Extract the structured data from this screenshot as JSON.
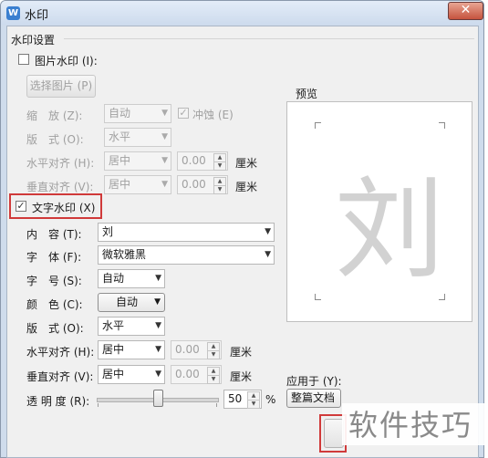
{
  "window": {
    "title": "水印",
    "app_icon": "wps-icon",
    "close_glyph": "✕"
  },
  "group": {
    "title": "水印设置"
  },
  "picture": {
    "checkbox_label": "图片水印 (I):",
    "checked": false,
    "select_button": "选择图片 (P)",
    "scale_label": "缩　放 (Z):",
    "scale_value": "自动",
    "washout_label": "冲蚀 (E)",
    "layout_label": "版　式 (O):",
    "layout_value": "水平",
    "halign_label": "水平对齐 (H):",
    "halign_value": "居中",
    "halign_offset": "0.00",
    "valign_label": "垂直对齐 (V):",
    "valign_value": "居中",
    "valign_offset": "0.00",
    "unit": "厘米"
  },
  "text_wm": {
    "checkbox_label": "文字水印 (X)",
    "checked": true,
    "content_label": "内　容 (T):",
    "content_value": "刘",
    "font_label": "字　体 (F):",
    "font_value": "微软雅黑",
    "size_label": "字　号 (S):",
    "size_value": "自动",
    "color_label": "颜　色 (C):",
    "color_value": "自动",
    "layout_label": "版　式 (O):",
    "layout_value": "水平",
    "halign_label": "水平对齐 (H):",
    "halign_value": "居中",
    "halign_offset": "0.00",
    "valign_label": "垂直对齐 (V):",
    "valign_value": "居中",
    "valign_offset": "0.00",
    "unit": "厘米",
    "transparency_label": "透 明 度 (R):",
    "transparency_value": "50",
    "transparency_unit": "%",
    "transparency_level": 0.5
  },
  "preview": {
    "label": "预览",
    "sample_char": "刘"
  },
  "apply": {
    "label": "应用于 (Y):",
    "value": "整篇文档"
  },
  "overlay": {
    "logo_text": "软件技巧"
  },
  "colors": {
    "highlight": "#d03a3a",
    "titlebar": "#cddbed",
    "close": "#c6533e"
  }
}
